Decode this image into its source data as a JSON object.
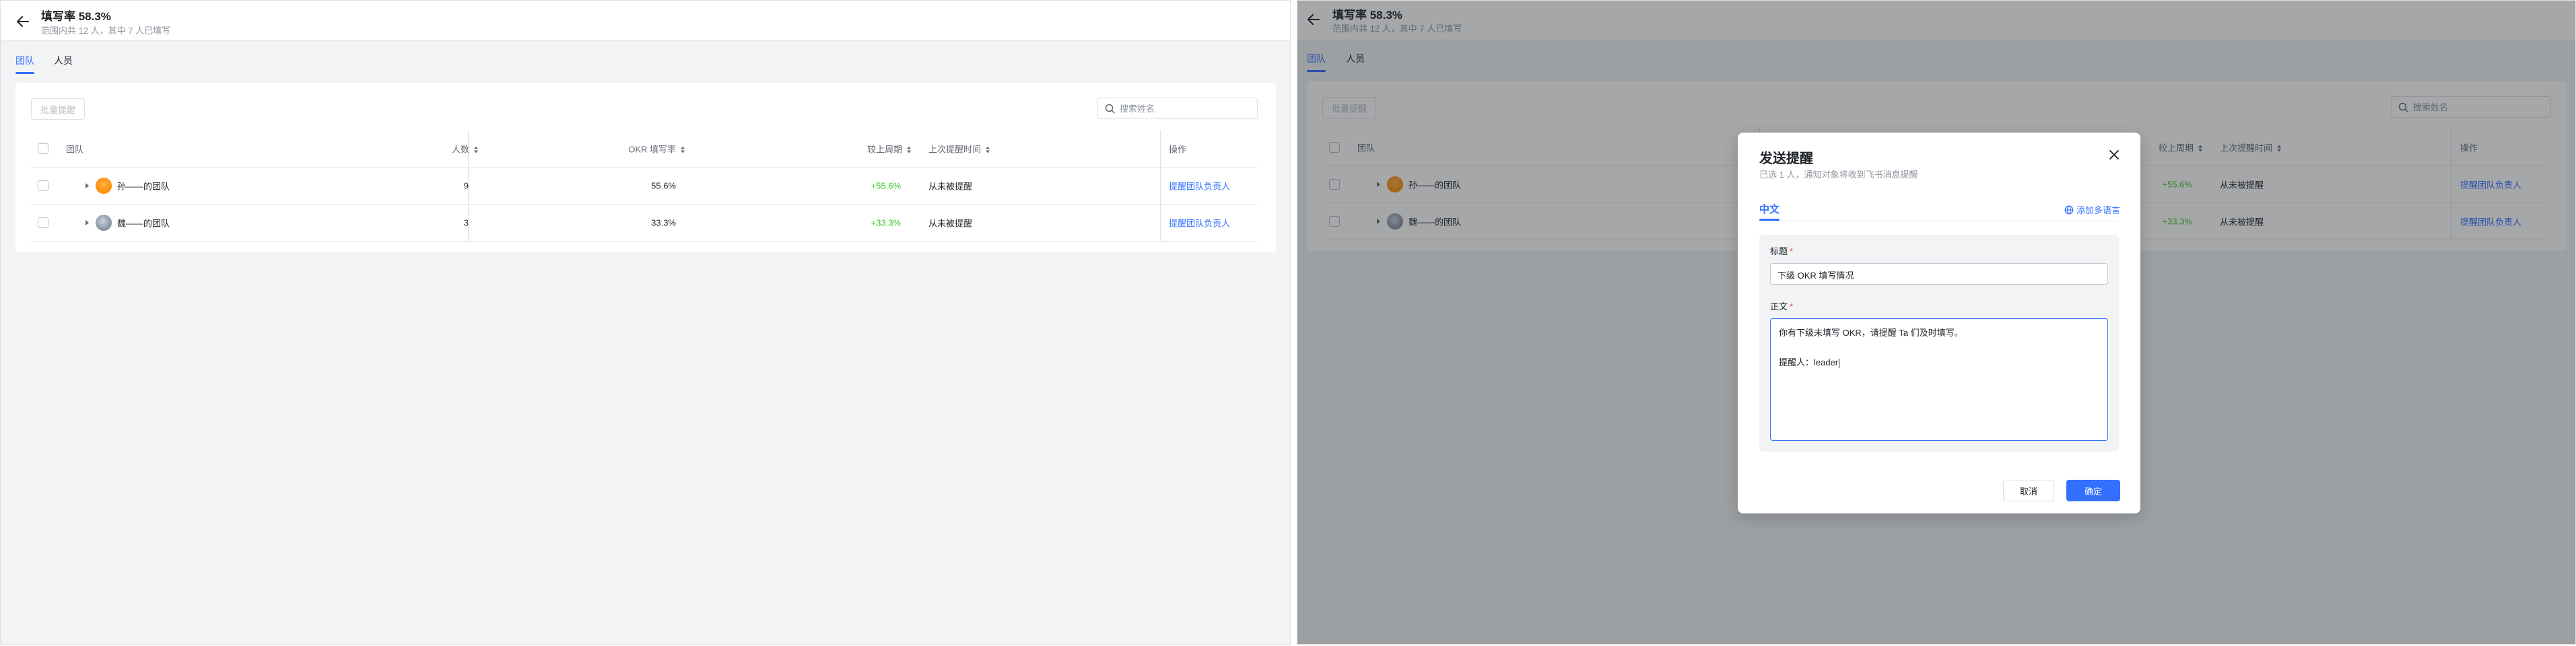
{
  "page": {
    "title": "填写率 58.3%",
    "subtitle": "范围内共 12 人，其中 7 人已填写",
    "tabs": [
      {
        "label": "团队",
        "active": true
      },
      {
        "label": "人员",
        "active": false
      }
    ]
  },
  "toolbar": {
    "batch_label": "批量提醒",
    "search_placeholder": "搜索姓名"
  },
  "table": {
    "columns": {
      "team": "团队",
      "count": "人数",
      "okr_rate": "OKR 填写率",
      "vs_last": "较上周期",
      "last_reminded": "上次提醒时间",
      "action": "操作"
    },
    "rows": [
      {
        "team": "孙——的团队",
        "avatar": "orange",
        "count": "9",
        "okr_rate": "55.6%",
        "vs_last": "+55.6%",
        "last_reminded": "从未被提醒",
        "action": "提醒团队负责人"
      },
      {
        "team": "魏——的团队",
        "avatar": "gray",
        "count": "3",
        "okr_rate": "33.3%",
        "vs_last": "+33.3%",
        "last_reminded": "从未被提醒",
        "action": "提醒团队负责人"
      }
    ]
  },
  "modal": {
    "title": "发送提醒",
    "subtitle": "已选 1 人，通知对象将收到飞书消息提醒",
    "language_tab": "中文",
    "add_language": "添加多语言",
    "title_label": "标题",
    "title_value": "下级 OKR 填写情况",
    "body_label": "正文",
    "body_line1": "你有下级未填写 OKR，请提醒 Ta 们及时填写。",
    "body_line2": "提醒人：leader",
    "cancel_label": "取消",
    "confirm_label": "确定",
    "required_mark": "*"
  },
  "colors": {
    "accent": "#3370ff",
    "positive": "#34c724",
    "overlay": "rgba(31,35,41,0.40)"
  },
  "icons": {
    "back": "arrow-left-icon",
    "search": "search-icon",
    "sort": "sort-icon",
    "expand": "caret-right-icon",
    "close": "close-icon",
    "globe": "globe-icon"
  }
}
